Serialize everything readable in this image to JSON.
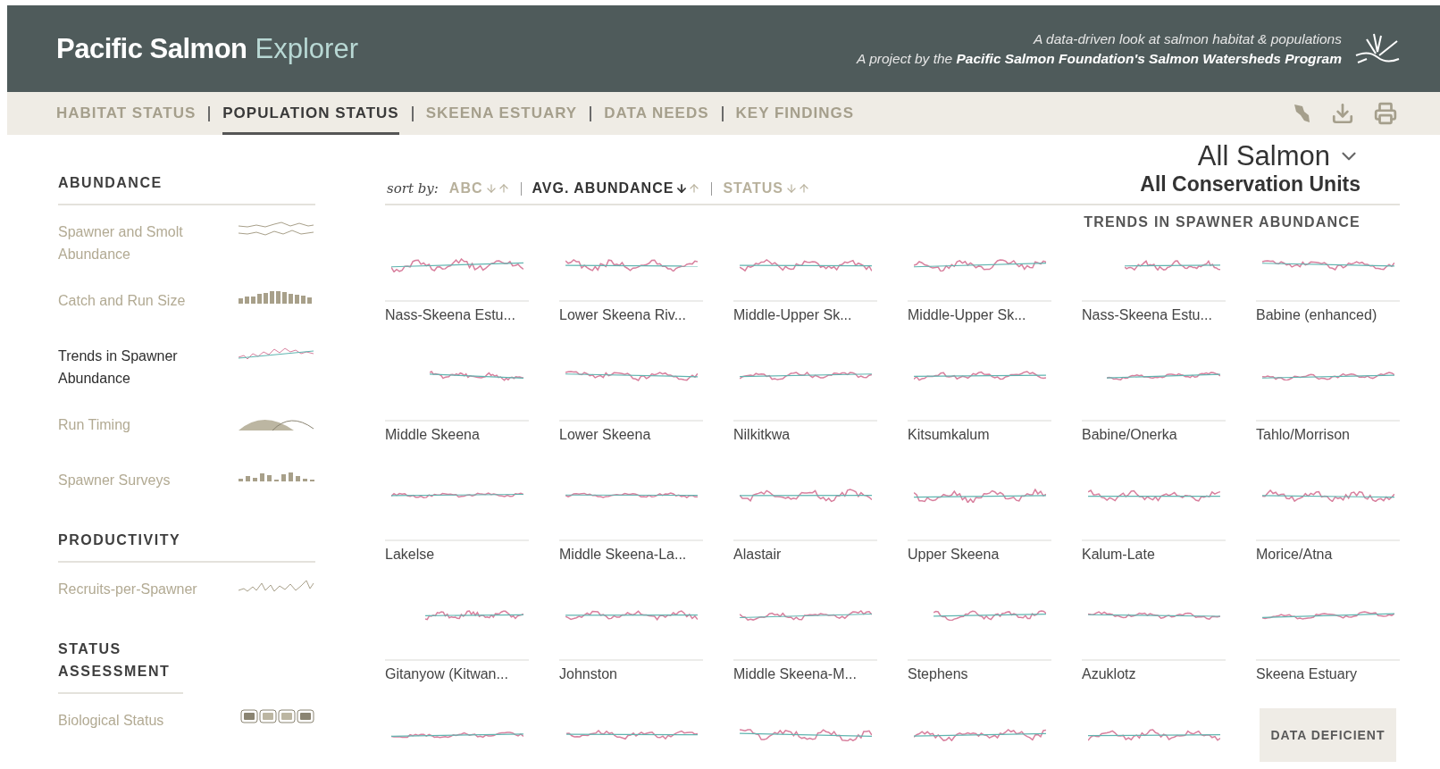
{
  "header": {
    "title": "Pacific Salmon",
    "title_suffix": "Explorer",
    "tagline": "A data-driven look at salmon habitat & populations",
    "credit": "A project by the **Pacific Salmon Foundation's Salmon Watersheds Program**"
  },
  "nav": {
    "tabs": [
      {
        "label": "HABITAT STATUS",
        "selected": false
      },
      {
        "label": "POPULATION STATUS",
        "selected": true
      },
      {
        "label": "SKEENA ESTUARY",
        "selected": false
      },
      {
        "label": "DATA NEEDS",
        "selected": false
      },
      {
        "label": "KEY FINDINGS",
        "selected": false
      }
    ]
  },
  "sidebar": {
    "sections": [
      {
        "heading": "ABUNDANCE",
        "items": [
          {
            "label": "Spawner and Smolt Abundance",
            "kind": "dual-line",
            "selected": false
          },
          {
            "label": "Catch and Run Size",
            "kind": "bars",
            "selected": false
          },
          {
            "label": "Trends in Spawner Abundance",
            "kind": "trend",
            "selected": true
          },
          {
            "label": "Run Timing",
            "kind": "timing",
            "selected": false
          },
          {
            "label": "Spawner Surveys",
            "kind": "surveys",
            "selected": false
          }
        ]
      },
      {
        "heading": "PRODUCTIVITY",
        "items": [
          {
            "label": "Recruits-per-Spawner",
            "kind": "line",
            "selected": false
          }
        ]
      },
      {
        "heading": "STATUS ASSESSMENT",
        "items": [
          {
            "label": "Biological Status",
            "kind": "status",
            "selected": false
          }
        ]
      }
    ]
  },
  "sort": {
    "label": "sort by:",
    "options": [
      {
        "label": "ABC",
        "selected": false
      },
      {
        "label": "AVG. ABUNDANCE",
        "selected": true
      },
      {
        "label": "STATUS",
        "selected": false
      }
    ]
  },
  "selector": {
    "species": "All Salmon",
    "units": "All Conservation Units"
  },
  "grid": {
    "heading": "TRENDS IN SPAWNER ABUNDANCE",
    "leading_charts": [
      {
        "kind": "trend"
      },
      {
        "kind": "trend"
      },
      {
        "kind": "trend"
      },
      {
        "kind": "trend"
      },
      {
        "kind": "trend"
      },
      {
        "kind": "trend"
      }
    ],
    "units": [
      {
        "name": "Nass-Skeena Estu...",
        "kind": "trend"
      },
      {
        "name": "Lower Skeena Riv...",
        "kind": "trend"
      },
      {
        "name": "Middle-Upper Sk...",
        "kind": "trend"
      },
      {
        "name": "Middle-Upper Sk...",
        "kind": "trend"
      },
      {
        "name": "Nass-Skeena Estu...",
        "kind": "trend"
      },
      {
        "name": "Babine (enhanced)",
        "kind": "trend"
      },
      {
        "name": "Middle Skeena",
        "kind": "trend"
      },
      {
        "name": "Lower Skeena",
        "kind": "trend"
      },
      {
        "name": "Nilkitkwa",
        "kind": "trend"
      },
      {
        "name": "Kitsumkalum",
        "kind": "trend"
      },
      {
        "name": "Babine/Onerka",
        "kind": "trend"
      },
      {
        "name": "Tahlo/Morrison",
        "kind": "trend"
      },
      {
        "name": "Lakelse",
        "kind": "trend"
      },
      {
        "name": "Middle Skeena-La...",
        "kind": "trend"
      },
      {
        "name": "Alastair",
        "kind": "trend"
      },
      {
        "name": "Upper Skeena",
        "kind": "trend"
      },
      {
        "name": "Kalum-Late",
        "kind": "trend"
      },
      {
        "name": "Morice/Atna",
        "kind": "trend"
      },
      {
        "name": "Gitanyow (Kitwan...",
        "kind": "trend"
      },
      {
        "name": "Johnston",
        "kind": "trend"
      },
      {
        "name": "Middle Skeena-M...",
        "kind": "trend"
      },
      {
        "name": "Stephens",
        "kind": "trend"
      },
      {
        "name": "Azuklotz",
        "kind": "trend"
      },
      {
        "name": "Skeena Estuary",
        "kind": "deficient",
        "badge": "DATA DEFICIENT"
      }
    ]
  }
}
